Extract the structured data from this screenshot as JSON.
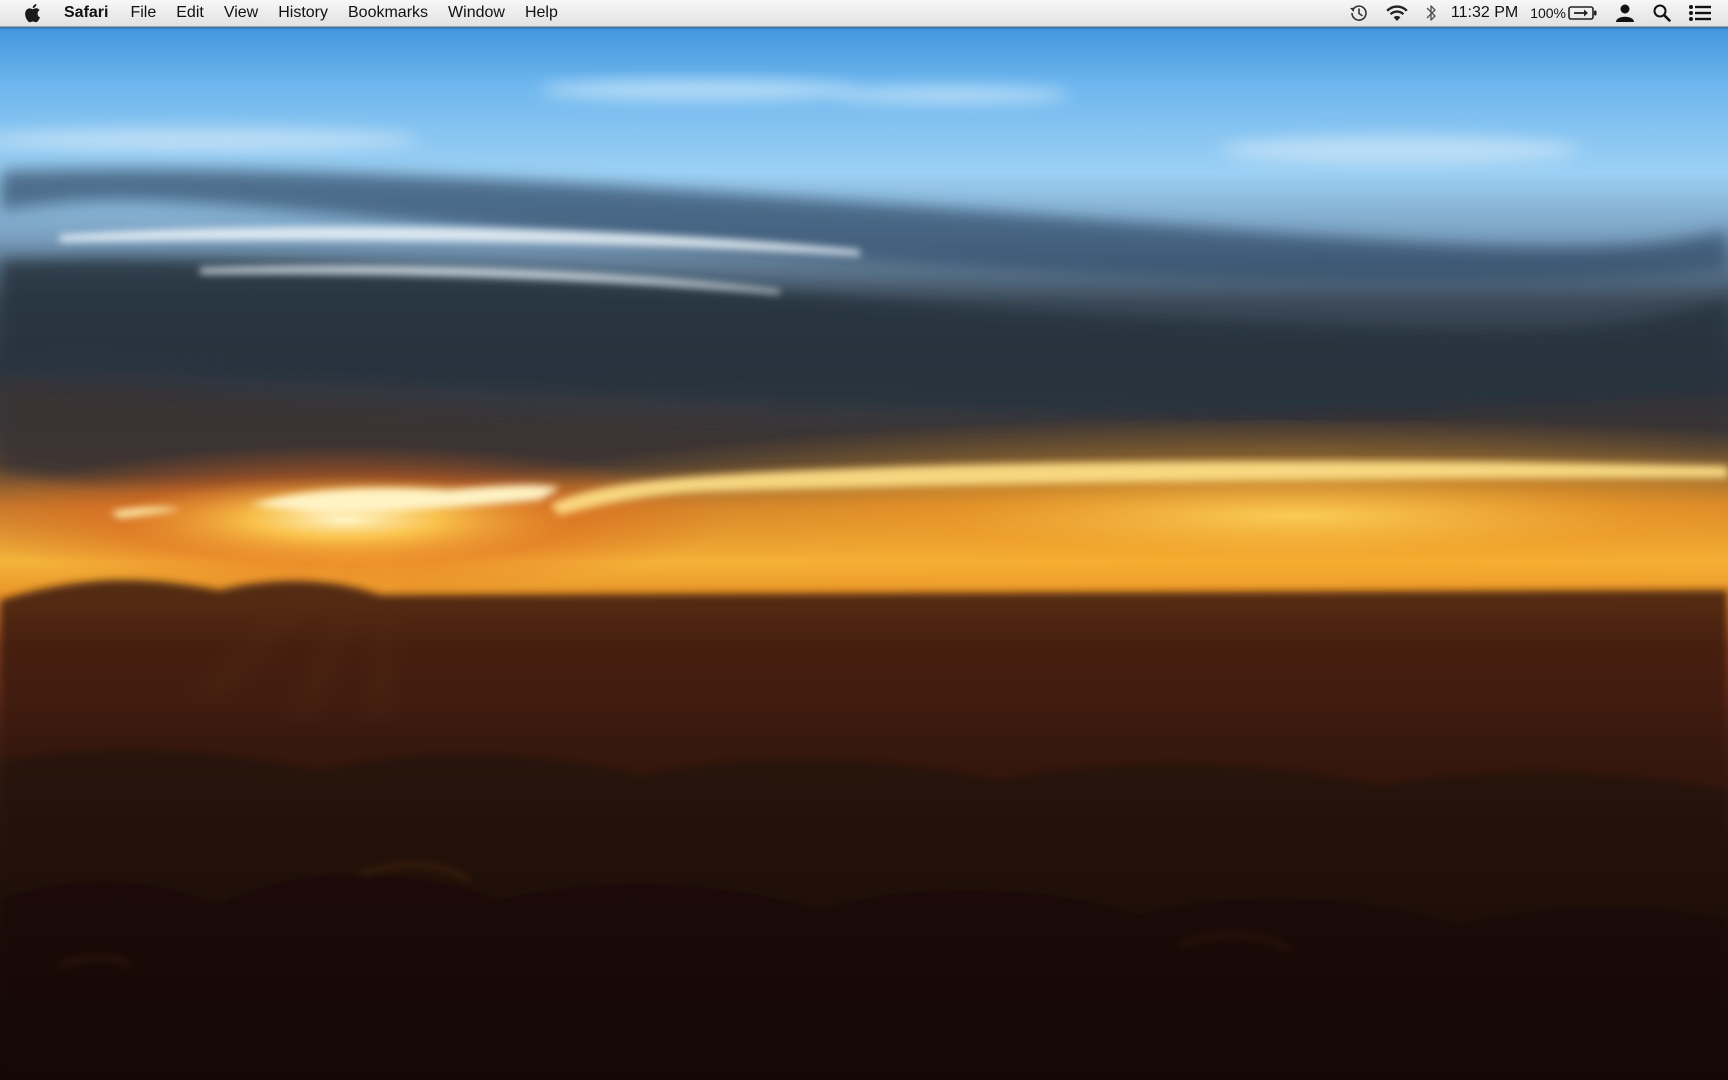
{
  "menubar": {
    "apple_icon": "apple-logo-icon",
    "app_name": "Safari",
    "menus": [
      "File",
      "Edit",
      "View",
      "History",
      "Bookmarks",
      "Window",
      "Help"
    ],
    "status": {
      "time_machine_icon": "time-machine-icon",
      "wifi_icon": "wifi-icon",
      "bluetooth_icon": "bluetooth-icon",
      "clock": "11:32 PM",
      "battery_percent": "100%",
      "battery_icon": "battery-charging-icon",
      "user_icon": "user-icon",
      "spotlight_icon": "spotlight-search-icon",
      "notifications_icon": "notification-center-icon"
    }
  },
  "desktop": {
    "wallpaper": "sunset-above-clouds",
    "colors": {
      "sky_top": "#3a8fd9",
      "sky_light": "#a9d6f5",
      "cloud_dark": "#2f3a46",
      "horizon_glow": "#f7b32b",
      "sun_core": "#fff2b0",
      "cloud_floor": "#2a140a"
    }
  }
}
